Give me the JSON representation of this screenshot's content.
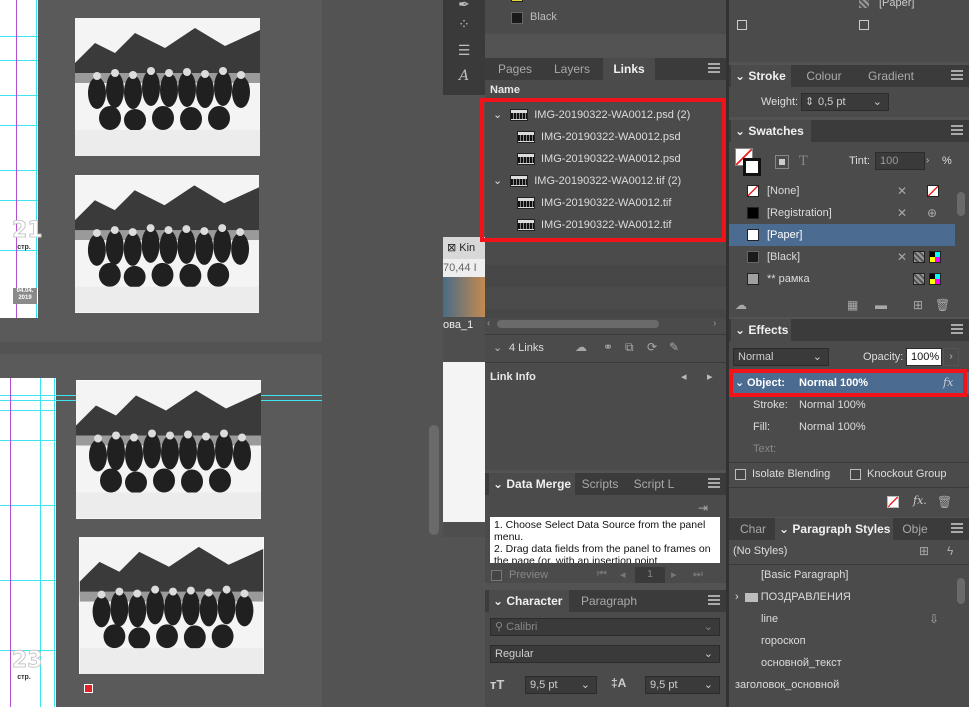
{
  "window": {
    "doc_tab_label": "Kin",
    "doc_tab_zoom": "70,44 I",
    "doc_tab_name": "ова_1"
  },
  "canvas": {
    "page_upper_number": "21",
    "page_upper_str": "стр.",
    "page_upper_date": "04.04. 2019",
    "page_lower_number": "23",
    "page_lower_str": "стр."
  },
  "colors": {
    "accent_red": "#f1121a",
    "selection_blue": "#4c6b91",
    "guide_cyan": "#3ce3f0",
    "margin_magenta": "#b34fd0",
    "panel_bg": "#4b4b4b"
  },
  "top_swatch_fragment": {
    "yellow_label": "Yellow",
    "black_label": "Black"
  },
  "links_panel": {
    "tabs": [
      "Pages",
      "Layers",
      "Links"
    ],
    "active_tab": "Links",
    "column_header": "Name",
    "items": [
      {
        "label": "IMG-20190322-WA0012.psd (2)",
        "level": 0,
        "expanded": true
      },
      {
        "label": "IMG-20190322-WA0012.psd",
        "level": 1
      },
      {
        "label": "IMG-20190322-WA0012.psd",
        "level": 1
      },
      {
        "label": "IMG-20190322-WA0012.tif (2)",
        "level": 0,
        "expanded": true
      },
      {
        "label": "IMG-20190322-WA0012.tif",
        "level": 1
      },
      {
        "label": "IMG-20190322-WA0012.tif",
        "level": 1
      }
    ],
    "count_label": "4 Links",
    "link_info_label": "Link Info"
  },
  "data_merge_panel": {
    "tabs": [
      "Data Merge",
      "Scripts",
      "Script L"
    ],
    "instructions": "1. Choose Select Data Source from the panel menu.\n2. Drag data fields from the panel to frames on the page (or, with an insertion point",
    "preview_label": "Preview",
    "record": "1"
  },
  "character_panel": {
    "tabs": [
      "Character",
      "Paragraph"
    ],
    "font": "Calibri",
    "style": "Regular",
    "size": "9,5 pt",
    "leading": "9,5 pt"
  },
  "fill_fragment": {
    "paper_label": "[Paper]"
  },
  "stroke_panel": {
    "tabs": [
      "Stroke",
      "Colour",
      "Gradient"
    ],
    "weight_label": "Weight:",
    "weight_value": "0,5 pt"
  },
  "swatches_panel": {
    "title": "Swatches",
    "tint_label": "Tint:",
    "tint_value": "100",
    "tint_unit": "%",
    "items": [
      {
        "label": "[None]",
        "color": "none"
      },
      {
        "label": "[Registration]",
        "color": "#000000"
      },
      {
        "label": "[Paper]",
        "color": "#ffffff",
        "selected": true
      },
      {
        "label": "[Black]",
        "color": "#1a1a1a"
      },
      {
        "label": "** рамка",
        "color": "#a0a0a0"
      }
    ]
  },
  "effects_panel": {
    "title": "Effects",
    "blend_mode": "Normal",
    "opacity_label": "Opacity:",
    "opacity_value": "100%",
    "rows": [
      {
        "label": "Object:",
        "value": "Normal 100%",
        "selected": true
      },
      {
        "label": "Stroke:",
        "value": "Normal 100%"
      },
      {
        "label": "Fill:",
        "value": "Normal 100%"
      },
      {
        "label": "Text:",
        "value": ""
      }
    ],
    "isolate_label": "Isolate Blending",
    "knockout_label": "Knockout Group"
  },
  "paragraph_styles_panel": {
    "tabs": [
      "Char",
      "Paragraph Styles",
      "Obje"
    ],
    "current": "(No Styles)",
    "items": [
      {
        "label": "[Basic Paragraph]",
        "folder": false
      },
      {
        "label": "ПОЗДРАВЛЕНИЯ",
        "folder": true
      },
      {
        "label": "line",
        "folder": false
      },
      {
        "label": "гороскоп",
        "folder": false
      },
      {
        "label": "основной_текст",
        "folder": false
      },
      {
        "label": "заголовок_основной",
        "folder": false
      }
    ]
  }
}
